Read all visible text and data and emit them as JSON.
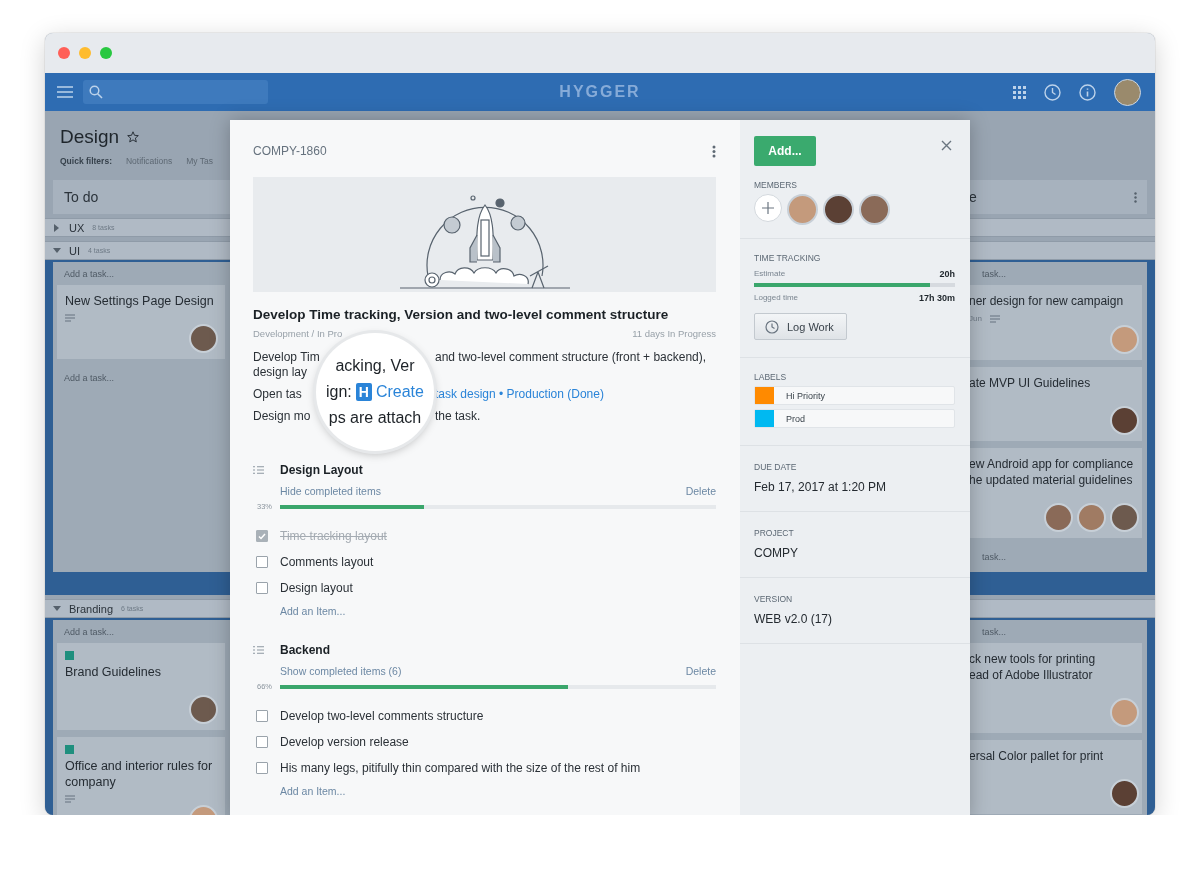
{
  "window": {
    "controls": [
      {
        "color": "#ff5f57"
      },
      {
        "color": "#febc2e"
      },
      {
        "color": "#28c840"
      }
    ]
  },
  "top_bar": {
    "logo": "HYGGER"
  },
  "board": {
    "title": "Design",
    "starred": false,
    "quick_filters_label": "Quick filters:",
    "quick_filters": [
      "Notifications",
      "My Tas"
    ],
    "columns": [
      {
        "title": "To do"
      },
      {
        "title": "e"
      }
    ],
    "swimlanes": [
      {
        "name": "UX",
        "count": "8 tasks",
        "expanded": false
      },
      {
        "name": "UI",
        "count": "4 tasks",
        "expanded": true,
        "cells": [
          {
            "add_top": "Add a task...",
            "add_bottom": "Add a task...",
            "cards": [
              {
                "lines": [
                  "New Settings Page Design"
                ],
                "has_comments": true,
                "members": [
                  {
                    "kind": "avatar"
                  }
                ]
              }
            ]
          },
          {
            "add_top": "task...",
            "add_bottom": "task...",
            "cards": [
              {
                "lines": [
                  "ner design for new campaign"
                ],
                "meta": "Jun",
                "has_comments": true,
                "members": [
                  {
                    "kind": "avatar"
                  }
                ]
              },
              {
                "lines": [
                  "ate MVP UI Guidelines"
                ],
                "has_comments": false,
                "members": [
                  {
                    "kind": "avatar"
                  }
                ]
              },
              {
                "lines": [
                  "ew Android app for compliance",
                  "he updated material guidelines"
                ],
                "has_comments": false,
                "members": [
                  {
                    "kind": "avatar"
                  },
                  {
                    "kind": "avatar"
                  },
                  {
                    "kind": "avatar"
                  }
                ]
              }
            ]
          }
        ]
      },
      {
        "name": "Branding",
        "count": "6 tasks",
        "expanded": true,
        "cells": [
          {
            "add_top": "Add a task...",
            "cards": [
              {
                "lines": [
                  "Brand Guidelines"
                ],
                "color": "#1f8f7e",
                "has_comments": false,
                "members": [
                  {
                    "kind": "avatar"
                  }
                ]
              },
              {
                "lines": [
                  "Office and interior rules for",
                  "company"
                ],
                "color": "#1f8f7e",
                "has_comments": true,
                "members": [
                  {
                    "kind": "avatar"
                  }
                ]
              }
            ]
          },
          {
            "add_top": "task...",
            "cards": [
              {
                "lines": [
                  "ck new tools for printing",
                  "ead of Adobe Illustrator"
                ],
                "has_comments": false,
                "members": [
                  {
                    "kind": "avatar"
                  }
                ]
              },
              {
                "lines": [
                  "ersal Color pallet for print"
                ],
                "has_comments": false,
                "members": [
                  {
                    "kind": "avatar"
                  }
                ]
              }
            ]
          }
        ]
      }
    ]
  },
  "task": {
    "key": "COMPY-1860",
    "title": "Develop Time tracking, Version and two-level comment structure",
    "breadcrumb": "Development / In Pro",
    "age": "11 days In Progress",
    "description": [
      {
        "lines": [
          {
            "left": "Develop Tim",
            "right": "and two-level comment structure (front + backend),",
            "kind": "text"
          },
          {
            "left": "design lay"
          }
        ]
      },
      {
        "lines": [
          {
            "left": "Open tas",
            "right": "task design • Production (Done)",
            "kind": "link"
          }
        ]
      },
      {
        "lines": [
          {
            "left": "Design mo",
            "right": "the task.",
            "kind": "text"
          }
        ]
      }
    ],
    "magnifier": {
      "top": "acking, Ver",
      "prefix": "ign:",
      "badge": "H",
      "link": "Create",
      "bottom": "ps are attach"
    },
    "checklists": [
      {
        "title": "Design Layout",
        "toggle": "Hide completed items",
        "delete": "Delete",
        "percent": "33%",
        "level": 0.33,
        "add": "Add an Item...",
        "items": [
          {
            "text": "Time tracking layout",
            "checked": true
          },
          {
            "text": "Comments layout",
            "checked": false
          },
          {
            "text": "Design layout",
            "checked": false
          }
        ]
      },
      {
        "title": "Backend",
        "toggle": "Show completed items (6)",
        "delete": "Delete",
        "percent": "66%",
        "level": 0.66,
        "add": "Add an Item...",
        "items": [
          {
            "text": "Develop two-level comments structure",
            "checked": false
          },
          {
            "text": "Develop version release",
            "checked": false
          },
          {
            "text": "His many legs, pitifully thin compared with the size of the rest of him",
            "checked": false
          }
        ]
      }
    ]
  },
  "sidebar": {
    "add_button": "Add...",
    "members_label": "MEMBERS",
    "members": [
      {
        "kind": "add"
      },
      {
        "kind": "avatar"
      },
      {
        "kind": "avatar"
      },
      {
        "kind": "avatar"
      }
    ],
    "time_tracking": {
      "label": "TIME TRACKING",
      "estimate_label": "Estimate",
      "estimate": "20h",
      "level": 0.875,
      "logged_label": "Logged time",
      "logged": "17h 30m",
      "button": "Log Work"
    },
    "labels_label": "LABELS",
    "labels": [
      {
        "name": "Hi Priority",
        "color": "#ff8a00"
      },
      {
        "name": "Prod",
        "color": "#00b9f1"
      }
    ],
    "fields": [
      {
        "label": "DUE DATE",
        "value": "Feb 17, 2017 at 1:20 PM"
      },
      {
        "label": "PROJECT",
        "value": "COMPY"
      },
      {
        "label": "VERSION",
        "value": "WEB v2.0 (17)"
      }
    ]
  }
}
